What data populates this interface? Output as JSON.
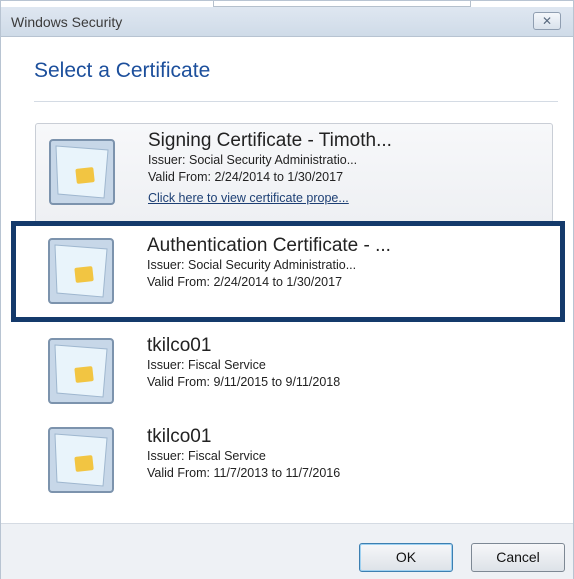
{
  "window": {
    "title": "Windows Security",
    "close_glyph": "✕"
  },
  "heading": "Select a Certificate",
  "certificates": [
    {
      "name": "Signing Certificate - Timoth...",
      "issuer": "Issuer: Social Security Administratio...",
      "valid": "Valid From: 2/24/2014 to 1/30/2017",
      "link": "Click here to view certificate prope...",
      "icon": "certificate-card-icon"
    },
    {
      "name": "Authentication Certificate - ...",
      "issuer": "Issuer: Social Security Administratio...",
      "valid": "Valid From: 2/24/2014 to 1/30/2017",
      "icon": "certificate-card-icon"
    },
    {
      "name": "tkilco01",
      "issuer": "Issuer: Fiscal Service",
      "valid": "Valid From: 9/11/2015 to 9/11/2018",
      "icon": "certificate-card-icon"
    },
    {
      "name": "tkilco01",
      "issuer": "Issuer: Fiscal Service",
      "valid": "Valid From: 11/7/2013 to 11/7/2016",
      "icon": "certificate-card-icon"
    }
  ],
  "buttons": {
    "ok": "OK",
    "cancel": "Cancel"
  },
  "colors": {
    "heading": "#1c4f9c",
    "selection_border": "#143a6b",
    "chip": "#f2c542"
  }
}
